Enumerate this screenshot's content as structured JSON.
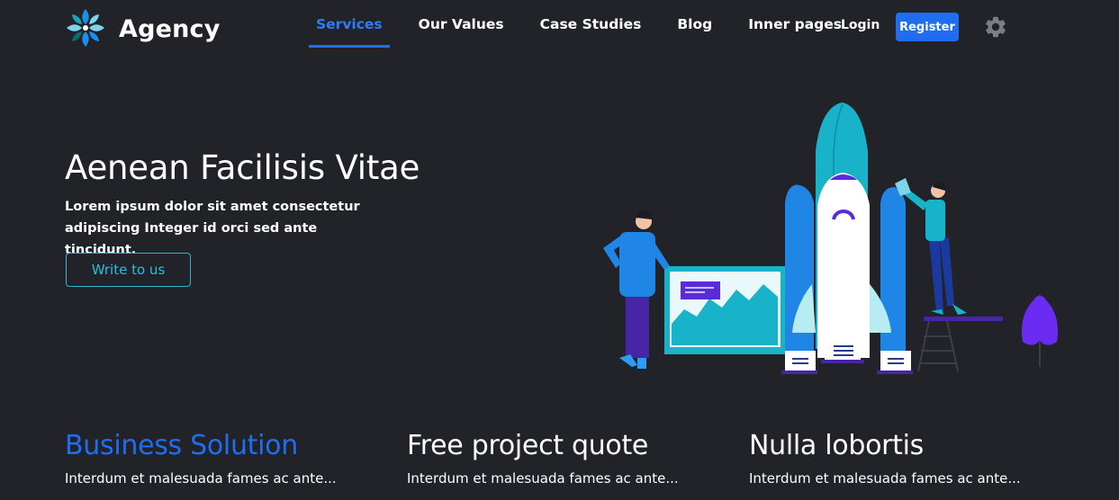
{
  "brand": {
    "name": "Agency",
    "logo_icon": "flower-logo-icon"
  },
  "nav": {
    "items": [
      {
        "label": "Services",
        "active": true
      },
      {
        "label": "Our Values",
        "active": false
      },
      {
        "label": "Case Studies",
        "active": false
      },
      {
        "label": "Blog",
        "active": false
      },
      {
        "label": "Inner pages",
        "active": false
      }
    ]
  },
  "auth": {
    "login_label": "Login",
    "register_label": "Register"
  },
  "settings_icon": "gear-icon",
  "hero": {
    "title": "Aenean Facilisis Vitae",
    "text": "Lorem ipsum dolor sit amet consectetur adipiscing Integer id orci sed ante tincidunt.",
    "cta_label": "Write to us",
    "illustration": "rocket-launch-illustration"
  },
  "features": [
    {
      "title": "Business Solution",
      "text": "Interdum et malesuada fames ac ante..."
    },
    {
      "title": "Free project quote",
      "text": "Interdum et malesuada fames ac ante..."
    },
    {
      "title": "Nulla lobortis",
      "text": "Interdum et malesuada fames ac ante..."
    }
  ],
  "colors": {
    "background": "#212329",
    "accent_blue": "#1f6ef2",
    "accent_cyan": "#27c1dc",
    "text": "#ffffff"
  }
}
